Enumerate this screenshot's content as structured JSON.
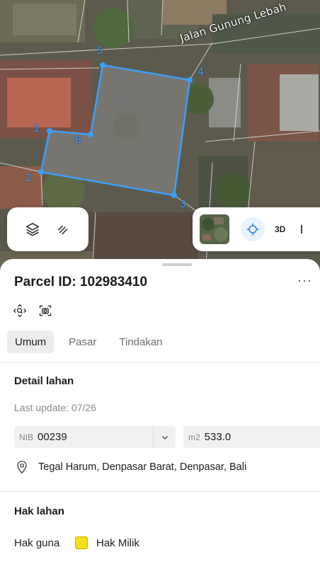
{
  "map": {
    "street_label": "Jalan Gunung Lebah",
    "parcel_color": "#3aa0ff",
    "vertices": [
      "1",
      "2",
      "3",
      "4",
      "5",
      "6"
    ]
  },
  "map_controls": {
    "layers_icon": "layers-icon",
    "measure_icon": "measure-icon",
    "locate_icon": "crosshair-icon",
    "view_3d_label": "3D"
  },
  "sheet": {
    "title": "Parcel ID: 102983410",
    "more_label": "···",
    "tabs": [
      {
        "label": "Umum",
        "active": true
      },
      {
        "label": "Pasar",
        "active": false
      },
      {
        "label": "Tindakan",
        "active": false
      }
    ],
    "detail": {
      "heading": "Detail lahan",
      "last_update": "Last update: 07/26",
      "nib_prefix": "NIB",
      "nib_value": "00239",
      "area_prefix": "m2",
      "area_value": "533.0",
      "address": "Tegal Harum, Denpasar Barat, Denpasar, Bali"
    },
    "rights": {
      "heading": "Hak lahan",
      "hak_guna_label": "Hak guna",
      "hak_guna_value": "Hak Milik",
      "hak_guna_color": "#f7df1e"
    }
  }
}
